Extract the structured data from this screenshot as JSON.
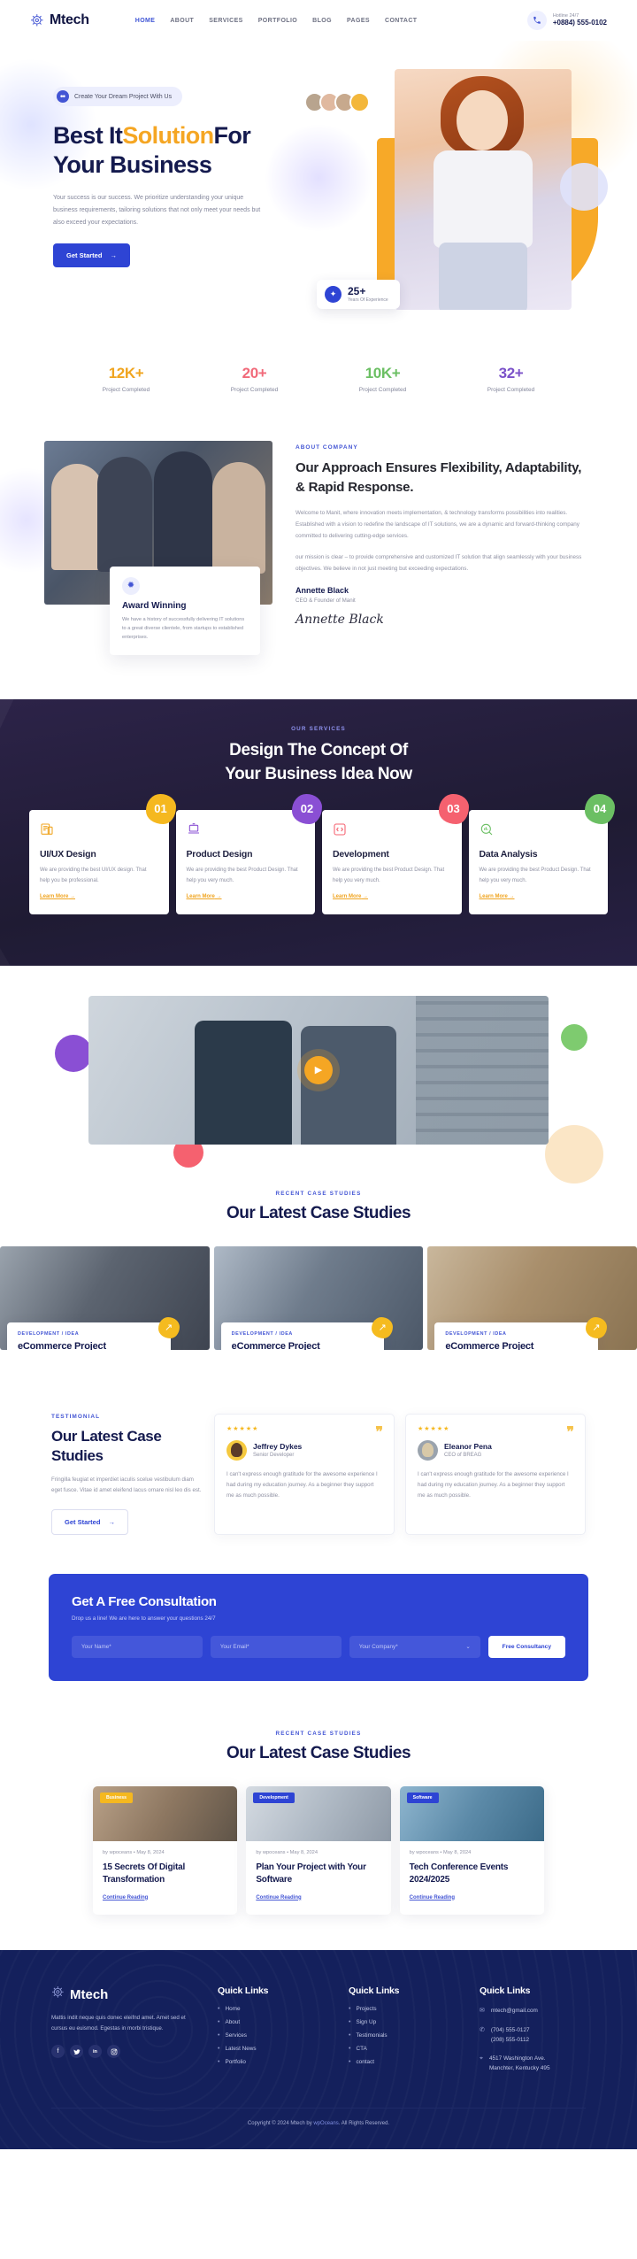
{
  "header": {
    "brand": "Mtech",
    "brand_icon": "gear-logo-icon",
    "nav": [
      {
        "label": "HOME",
        "active": true
      },
      {
        "label": "ABOUT",
        "active": false
      },
      {
        "label": "SERVICES",
        "active": false
      },
      {
        "label": "PORTFOLIO",
        "active": false
      },
      {
        "label": "BLOG",
        "active": false
      },
      {
        "label": "PAGES",
        "active": false
      },
      {
        "label": "CONTACT",
        "active": false
      }
    ],
    "phone_icon": "phone-icon",
    "phone_label": "Hotline 24/7",
    "phone_number": "+0884) 555-0102"
  },
  "hero": {
    "pill_icon": "chat-bubble-icon",
    "pill_text": "Create Your Dream Project With Us",
    "title_part1": "Best It",
    "title_accent": "Solution",
    "title_part2": "For",
    "title_line2": "Your Business",
    "description": "Your success is our success. We prioritize understanding your unique business requirements, tailoring solutions that not only meet your needs but also exceed your expectations.",
    "cta_label": "Get Started",
    "cta_arrow": "arrow-right-icon",
    "badge_icon": "award-icon",
    "badge_number": "25+",
    "badge_label": "Years Of Experience"
  },
  "stats": [
    {
      "value": "12K+",
      "label": "Project Completed",
      "color": "#f0a520"
    },
    {
      "value": "20+",
      "label": "Project Completed",
      "color": "#f16a7a"
    },
    {
      "value": "10K+",
      "label": "Project Completed",
      "color": "#6bbf63"
    },
    {
      "value": "32+",
      "label": "Project Completed",
      "color": "#7b52c9"
    }
  ],
  "about": {
    "award_icon": "badge-award-icon",
    "award_title": "Award Winning",
    "award_desc": "We have a history of successfully delivering IT solutions to a great diverse clientele, from startups to established enterprises.",
    "eyebrow": "ABOUT COMPANY",
    "heading": "Our Approach Ensures Flexibility, Adaptability, & Rapid Response.",
    "paragraph1": "Welcome to Manit, where innovation meets implementation, & technology transforms possibilities into realities. Established with a vision to redefine the landscape of IT solutions, we are a dynamic and forward-thinking company committed to delivering cutting-edge services.",
    "paragraph2": "our mission is clear – to provide comprehensive and customized IT solution that align seamlessly with your business objectives. We believe in not just meeting but exceeding expectations.",
    "person_name": "Annette Black",
    "person_role": "CEO & Founder of Manit",
    "signature": "Annette Black"
  },
  "services": {
    "eyebrow": "OUR SERVICES",
    "heading_line1": "Design The Concept Of",
    "heading_line2": "Your Business Idea Now",
    "cards": [
      {
        "number": "01",
        "badge_color": "#f5b81f",
        "icon": "document-layout-icon",
        "icon_color": "#f0a520",
        "title": "UI/UX Design",
        "desc": "We are providing the best UI/UX design. That help you be professional.",
        "link": "Learn More"
      },
      {
        "number": "02",
        "badge_color": "#8a4fd4",
        "icon": "laptop-icon",
        "icon_color": "#8a4fd4",
        "title": "Product Design",
        "desc": "We are providing the best Product Design. That help you very much.",
        "link": "Learn More"
      },
      {
        "number": "03",
        "badge_color": "#f5616f",
        "icon": "code-brackets-icon",
        "icon_color": "#f5616f",
        "title": "Development",
        "desc": "We are providing the best Product Design. That help you very much.",
        "link": "Learn More"
      },
      {
        "number": "04",
        "badge_color": "#6bbf63",
        "icon": "chart-search-icon",
        "icon_color": "#6bbf63",
        "title": "Data Analysis",
        "desc": "We are providing the best Product Design. That help you very much.",
        "link": "Learn More"
      }
    ]
  },
  "video": {
    "play_icon": "play-triangle-icon"
  },
  "case_studies": {
    "eyebrow": "RECENT CASE STUDIES",
    "heading": "Our Latest Case Studies",
    "items": [
      {
        "tag": "DEVELOPMENT / IDEA",
        "title": "eCommerce Project",
        "arrow": "arrow-up-right-icon"
      },
      {
        "tag": "DEVELOPMENT / IDEA",
        "title": "eCommerce Project",
        "arrow": "arrow-up-right-icon"
      },
      {
        "tag": "DEVELOPMENT / IDEA",
        "title": "eCommerce Project",
        "arrow": "arrow-up-right-icon"
      }
    ]
  },
  "testimonial": {
    "eyebrow": "TESTIMONIAL",
    "heading": "Our Latest Case Studies",
    "paragraph": "Fringilla feugiat et imperdiet iaculis scelue vestibulum diam eget fusce. Vitae id amet eleifend lacus ornare nisl leo dis est.",
    "cta_label": "Get Started",
    "cards": [
      {
        "stars": "★★★★★",
        "quote_icon": "quote-marks-icon",
        "name": "Jeffrey Dykes",
        "role": "Senior Developer",
        "text": "I can't express enough gratitude for the awesome experience I had during my education journey. As a beginner they support me as much possible."
      },
      {
        "stars": "★★★★★",
        "quote_icon": "quote-marks-icon",
        "name": "Eleanor Pena",
        "role": "CEO of BREAG",
        "text": "I can't express enough gratitude for the awesome experience I had during my education journey. As a beginner they support me as much possible."
      }
    ]
  },
  "consultation": {
    "heading": "Get A Free Consultation",
    "subtext": "Drop us a line! We are here to answer your questions 24/7",
    "name_placeholder": "Your Name*",
    "email_placeholder": "Your Email*",
    "company_value": "Your Company*",
    "company_caret": "chevron-down-icon",
    "submit_label": "Free Consultancy"
  },
  "blog": {
    "eyebrow": "RECENT CASE STUDIES",
    "heading": "Our Latest Case Studies",
    "posts": [
      {
        "tag": "Business",
        "tag_color": "#f5b81f",
        "meta": "by wpoceans  •  May 8, 2024",
        "title": "15 Secrets Of Digital Transformation",
        "link": "Continue Reading"
      },
      {
        "tag": "Development",
        "tag_color": "#2e44d4",
        "meta": "by wpoceans  •  May 8, 2024",
        "title": "Plan Your Project with Your Software",
        "link": "Continue Reading"
      },
      {
        "tag": "Software",
        "tag_color": "#2e44d4",
        "meta": "by wpoceans  •  May 8, 2024",
        "title": "Tech Conference Events 2024/2025",
        "link": "Continue Reading"
      }
    ]
  },
  "footer": {
    "brand": "Mtech",
    "brand_icon": "gear-logo-icon",
    "description": "Mattis indit neque quis donec eleifnd amet. Amet sed et cursus eu euismod. Egestas in morbi tristique.",
    "social": [
      {
        "icon": "facebook-icon",
        "glyph": "f"
      },
      {
        "icon": "twitter-icon",
        "glyph": "🐦"
      },
      {
        "icon": "linkedin-icon",
        "glyph": "in"
      },
      {
        "icon": "instagram-icon",
        "glyph": "◎"
      }
    ],
    "col1_heading": "Quick Links",
    "col1_items": [
      "Home",
      "About",
      "Services",
      "Latest News",
      "Portfolio"
    ],
    "col2_heading": "Quick Links",
    "col2_items": [
      "Projects",
      "Sign Up",
      "Testimonials",
      "CTA",
      "contact"
    ],
    "col3_heading": "Quick Links",
    "contacts": [
      {
        "icon": "envelope-icon",
        "line1": "mtech@gmail.com",
        "line2": ""
      },
      {
        "icon": "phone-icon",
        "line1": "(704) 555-0127",
        "line2": "(208) 555-0112"
      },
      {
        "icon": "location-pin-icon",
        "line1": "4517 Washington Ave.",
        "line2": "Manchter, Kentucky 495"
      }
    ],
    "copyright_pre": "Copyright © 2024 Mtech by ",
    "copyright_link": "wpOceans",
    "copyright_post": ". All Rights Reserved."
  }
}
